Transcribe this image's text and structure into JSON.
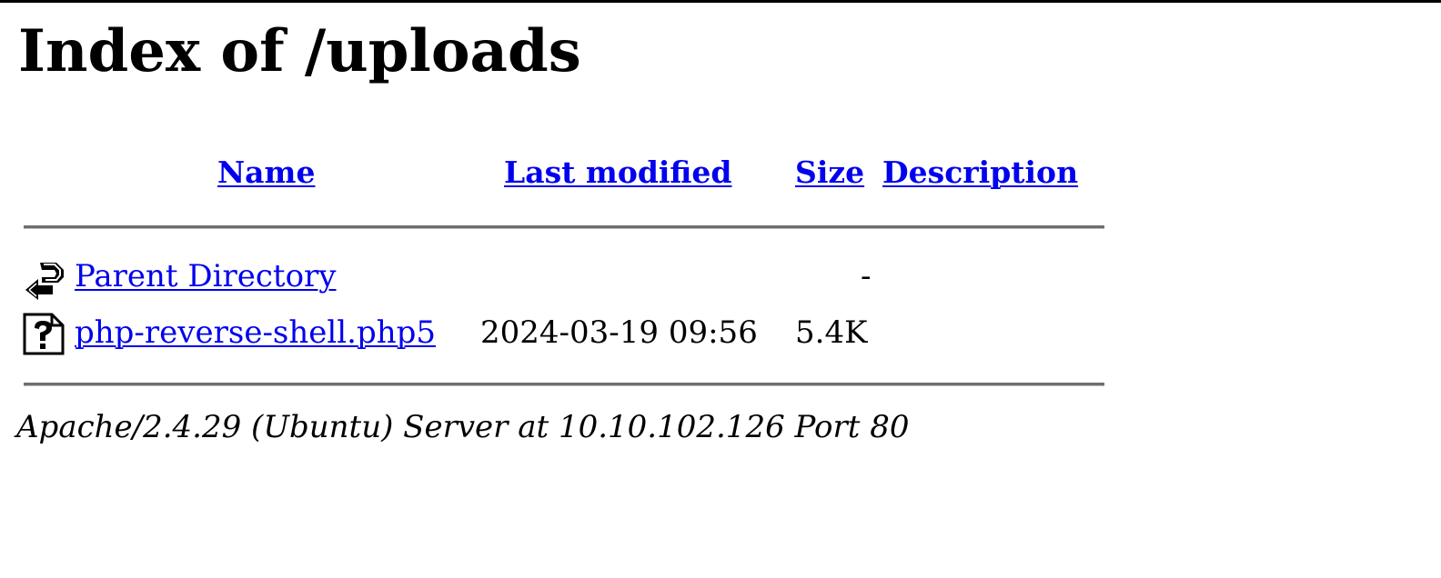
{
  "page": {
    "title": "Index of /uploads"
  },
  "table": {
    "headers": {
      "name": "Name",
      "last_modified": "Last modified",
      "size": "Size",
      "description": "Description"
    },
    "rows": [
      {
        "icon": "back-arrow-icon",
        "name": "Parent Directory",
        "last_modified": "",
        "size": "-",
        "description": ""
      },
      {
        "icon": "unknown-file-icon",
        "name": "php-reverse-shell.php5",
        "last_modified": "2024-03-19 09:56",
        "size": "5.4K",
        "description": ""
      }
    ]
  },
  "footer": {
    "server_signature": "Apache/2.4.29 (Ubuntu) Server at 10.10.102.126 Port 80"
  },
  "colors": {
    "link": "#0000ee",
    "text": "#000000",
    "rule": "#6e6e6e"
  }
}
